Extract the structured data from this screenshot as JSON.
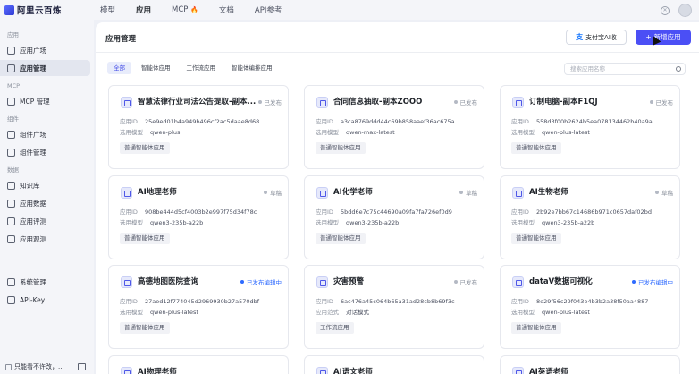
{
  "topbar": {
    "logo_text": "阿里云百炼",
    "nav": [
      "模型",
      "应用",
      "MCP",
      "文档",
      "API参考"
    ],
    "mcp_fire": "🔥"
  },
  "sidebar": {
    "sections": [
      {
        "title": "应用",
        "items": [
          "应用广场",
          "应用管理"
        ]
      },
      {
        "title": "MCP",
        "items": [
          "MCP 管理"
        ]
      },
      {
        "title": "组件",
        "items": [
          "组件广场",
          "组件管理"
        ]
      },
      {
        "title": "数据",
        "items": [
          "知识库",
          "应用数据",
          "应用评测",
          "应用观测"
        ]
      },
      {
        "title": "",
        "items": [
          "系统管理",
          "API-Key"
        ]
      }
    ],
    "footer_text": "只能看不许改，..."
  },
  "main": {
    "title": "应用管理",
    "alipay_label": "支付宝AI收",
    "new_app_label": "新增应用",
    "tabs": [
      "全部",
      "智能体应用",
      "工作流应用",
      "智能体编排应用"
    ],
    "search_placeholder": "搜索应用名称",
    "cards": [
      {
        "title": "智慧法律行业司法公告提取-副本...",
        "status": "已发布",
        "id_label": "应用ID",
        "id": "25e9ed01b4a949b496cf2ac5daae8d68",
        "model_label": "选用模型",
        "model": "qwen-plus",
        "tag": "普通智能体应用"
      },
      {
        "title": "合同信息抽取-副本ZOOO",
        "status": "已发布",
        "id_label": "应用ID",
        "id": "a3ca8769ddd44c69b858aaef36ac675a",
        "model_label": "选用模型",
        "model": "qwen-max-latest",
        "tag": "普通智能体应用"
      },
      {
        "title": "订制电脑-副本F1QJ",
        "status": "已发布",
        "id_label": "应用ID",
        "id": "558d3f00b2624b5ea078134462b40a9a",
        "model_label": "选用模型",
        "model": "qwen-plus-latest",
        "tag": "普通智能体应用"
      },
      {
        "title": "AI地理老师",
        "status": "草稿",
        "id_label": "应用ID",
        "id": "908be444d5cf4003b2e997f75d34f78c",
        "model_label": "选用模型",
        "model": "qwen3-235b-a22b",
        "tag": "普通智能体应用"
      },
      {
        "title": "AI化学老师",
        "status": "草稿",
        "id_label": "应用ID",
        "id": "5bdd6e7c75c44690a09fa7fa726ef0d9",
        "model_label": "选用模型",
        "model": "qwen3-235b-a22b",
        "tag": "普通智能体应用"
      },
      {
        "title": "AI生物老师",
        "status": "草稿",
        "id_label": "应用ID",
        "id": "2b92e7bb67c14686b971c0657daf02bd",
        "model_label": "选用模型",
        "model": "qwen3-235b-a22b",
        "tag": "普通智能体应用"
      },
      {
        "title": "高德地图医院查询",
        "status": "已发布编辑中",
        "id_label": "应用ID",
        "id": "27aed12f774045d2969930b27a570dbf",
        "model_label": "选用模型",
        "model": "qwen-plus-latest",
        "tag": "普通智能体应用"
      },
      {
        "title": "灾害预警",
        "status": "已发布",
        "id_label": "应用ID",
        "id": "6ac476a45c064b65a31ad28cb8b69f3c",
        "model_label": "应用范式",
        "model": "对话模式",
        "tag": "工作流应用"
      },
      {
        "title": "dataV数据可视化",
        "status": "已发布编辑中",
        "id_label": "应用ID",
        "id": "8e29f56c29f043e4b3b2a38f50aa4887",
        "model_label": "选用模型",
        "model": "qwen-plus-latest",
        "tag": "普通智能体应用"
      }
    ],
    "partial_cards": [
      "AI物理老师",
      "AI语文老师",
      "AI英语老师"
    ]
  },
  "colors": {
    "accent": "#4b4ff5",
    "status_blue": "#2f6bff"
  }
}
